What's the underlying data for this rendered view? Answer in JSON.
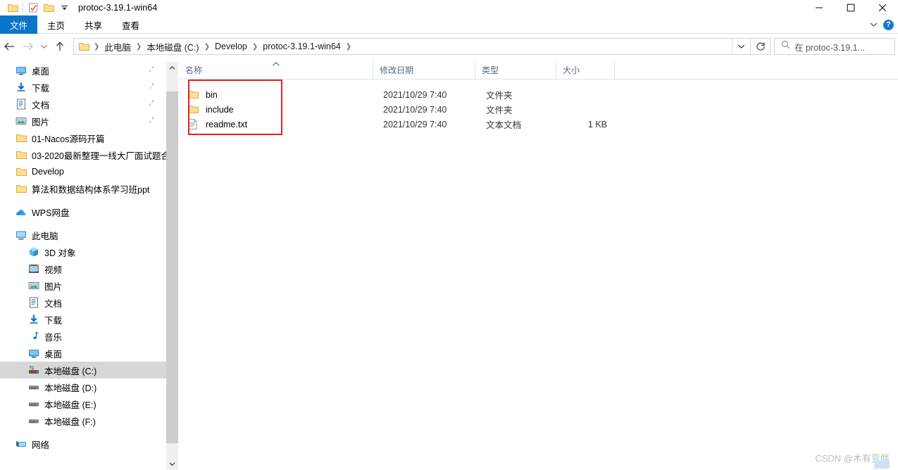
{
  "window": {
    "title": "protoc-3.19.1-win64",
    "quick_access": [
      {
        "name": "folder-icon",
        "label": "文件夹"
      },
      {
        "name": "properties-icon",
        "label": "属性"
      },
      {
        "name": "new-folder-icon",
        "label": "新建文件夹"
      },
      {
        "name": "customize-dropdown-icon",
        "label": "自定义快速访问工具栏"
      }
    ],
    "controls": {
      "minimize": "最小化",
      "maximize": "最大化",
      "close": "关闭"
    }
  },
  "ribbon": {
    "tabs": [
      {
        "label": "文件",
        "active": true
      },
      {
        "label": "主页",
        "active": false
      },
      {
        "label": "共享",
        "active": false
      },
      {
        "label": "查看",
        "active": false
      }
    ],
    "expand_label": "展开功能区",
    "help_label": "帮助"
  },
  "navbar": {
    "back_label": "后退",
    "forward_label": "前进",
    "recent_label": "最近浏览的位置",
    "up_label": "上移到上一级",
    "breadcrumbs": [
      "此电脑",
      "本地磁盘 (C:)",
      "Develop",
      "protoc-3.19.1-win64"
    ],
    "address_dropdown_label": "以前的位置",
    "refresh_label": "刷新",
    "search": {
      "placeholder": "在 protoc-3.19.1...",
      "value": ""
    }
  },
  "sidebar": {
    "quick_access": [
      {
        "label": "桌面",
        "icon": "desktop-icon",
        "pinned": true
      },
      {
        "label": "下载",
        "icon": "downloads-icon",
        "pinned": true
      },
      {
        "label": "文档",
        "icon": "documents-icon",
        "pinned": true
      },
      {
        "label": "图片",
        "icon": "pictures-icon",
        "pinned": true
      },
      {
        "label": "01-Nacos源码开篇",
        "icon": "folder-icon",
        "pinned": false
      },
      {
        "label": "03-2020最新整理一线大厂面试题合",
        "icon": "folder-icon",
        "pinned": false
      },
      {
        "label": "Develop",
        "icon": "folder-icon",
        "pinned": false
      },
      {
        "label": "算法和数据结构体系学习班ppt",
        "icon": "folder-icon",
        "pinned": false
      }
    ],
    "cloud": {
      "label": "WPS网盘",
      "icon": "cloud-icon"
    },
    "this_pc": {
      "label": "此电脑",
      "icon": "computer-icon",
      "children": [
        {
          "label": "3D 对象",
          "icon": "3d-objects-icon",
          "selected": false
        },
        {
          "label": "视频",
          "icon": "videos-icon",
          "selected": false
        },
        {
          "label": "图片",
          "icon": "pictures-icon",
          "selected": false
        },
        {
          "label": "文档",
          "icon": "documents-icon",
          "selected": false
        },
        {
          "label": "下载",
          "icon": "downloads-icon",
          "selected": false
        },
        {
          "label": "音乐",
          "icon": "music-icon",
          "selected": false
        },
        {
          "label": "桌面",
          "icon": "desktop-icon",
          "selected": false
        },
        {
          "label": "本地磁盘 (C:)",
          "icon": "system-drive-icon",
          "selected": true
        },
        {
          "label": "本地磁盘 (D:)",
          "icon": "drive-icon",
          "selected": false
        },
        {
          "label": "本地磁盘 (E:)",
          "icon": "drive-icon",
          "selected": false
        },
        {
          "label": "本地磁盘 (F:)",
          "icon": "drive-icon",
          "selected": false
        }
      ]
    },
    "network": {
      "label": "网络",
      "icon": "network-icon"
    }
  },
  "filelist": {
    "columns": [
      {
        "label": "名称",
        "sorted": true,
        "sort_dir": "asc"
      },
      {
        "label": "修改日期",
        "sorted": false
      },
      {
        "label": "类型",
        "sorted": false
      },
      {
        "label": "大小",
        "sorted": false
      }
    ],
    "rows": [
      {
        "name": "bin",
        "date": "2021/10/29 7:40",
        "type": "文件夹",
        "size": "",
        "icon": "folder-icon"
      },
      {
        "name": "include",
        "date": "2021/10/29 7:40",
        "type": "文件夹",
        "size": "",
        "icon": "folder-icon"
      },
      {
        "name": "readme.txt",
        "date": "2021/10/29 7:40",
        "type": "文本文档",
        "size": "1 KB",
        "icon": "text-file-icon"
      }
    ]
  },
  "annotation": {
    "color": "#e8211e",
    "shape": "rectangle",
    "target": "文件列表中的 bin / include / readme.txt 项"
  },
  "watermark": {
    "text": "CSDN @木有变胖"
  },
  "colors": {
    "accent": "#0b76c8",
    "selection": "#d7d7d7",
    "header_text": "#4a6b8a",
    "annotation": "#e8211e",
    "folder": "#fcdf8f"
  }
}
